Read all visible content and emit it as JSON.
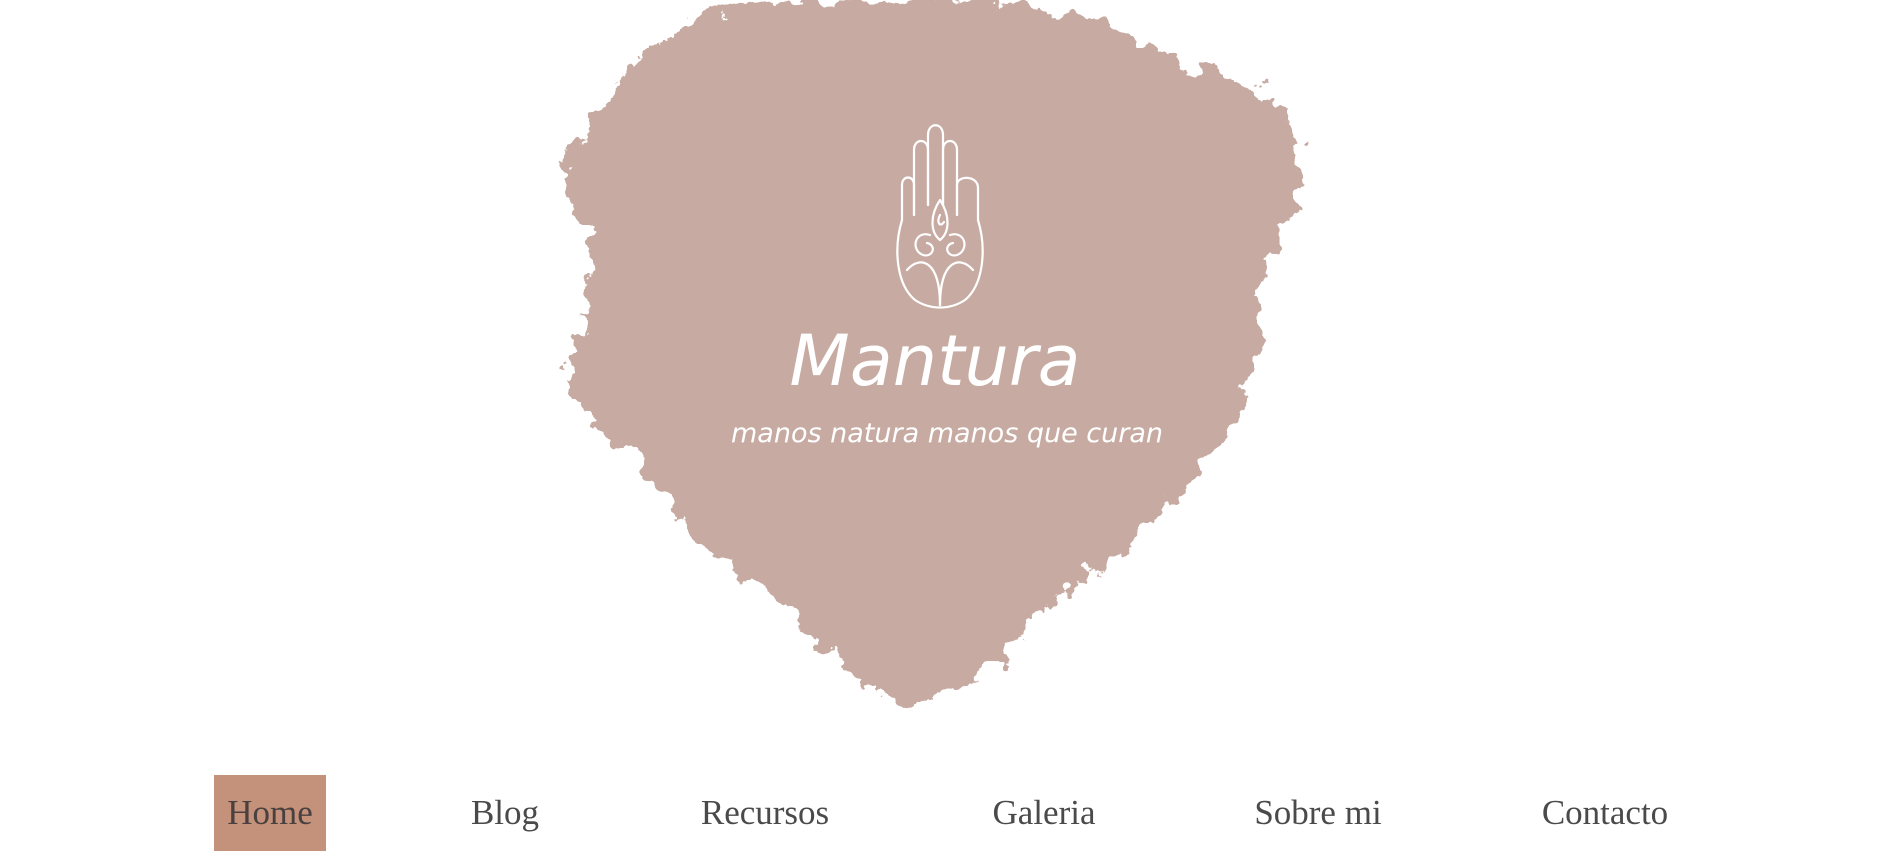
{
  "brand": {
    "name": "Mantura",
    "tagline": "manos natura manos que curan"
  },
  "colors": {
    "splash": "#c7aba2",
    "logo_ink": "#ffffff",
    "nav_active_bg": "#c4917a",
    "nav_text": "#4a4a4a",
    "background": "#ffffff"
  },
  "nav": {
    "items": [
      {
        "label": "Home",
        "active": true
      },
      {
        "label": "Blog",
        "active": false
      },
      {
        "label": "Recursos",
        "active": false
      },
      {
        "label": "Galeria",
        "active": false
      },
      {
        "label": "Sobre mi",
        "active": false
      },
      {
        "label": "Contacto",
        "active": false
      }
    ]
  }
}
